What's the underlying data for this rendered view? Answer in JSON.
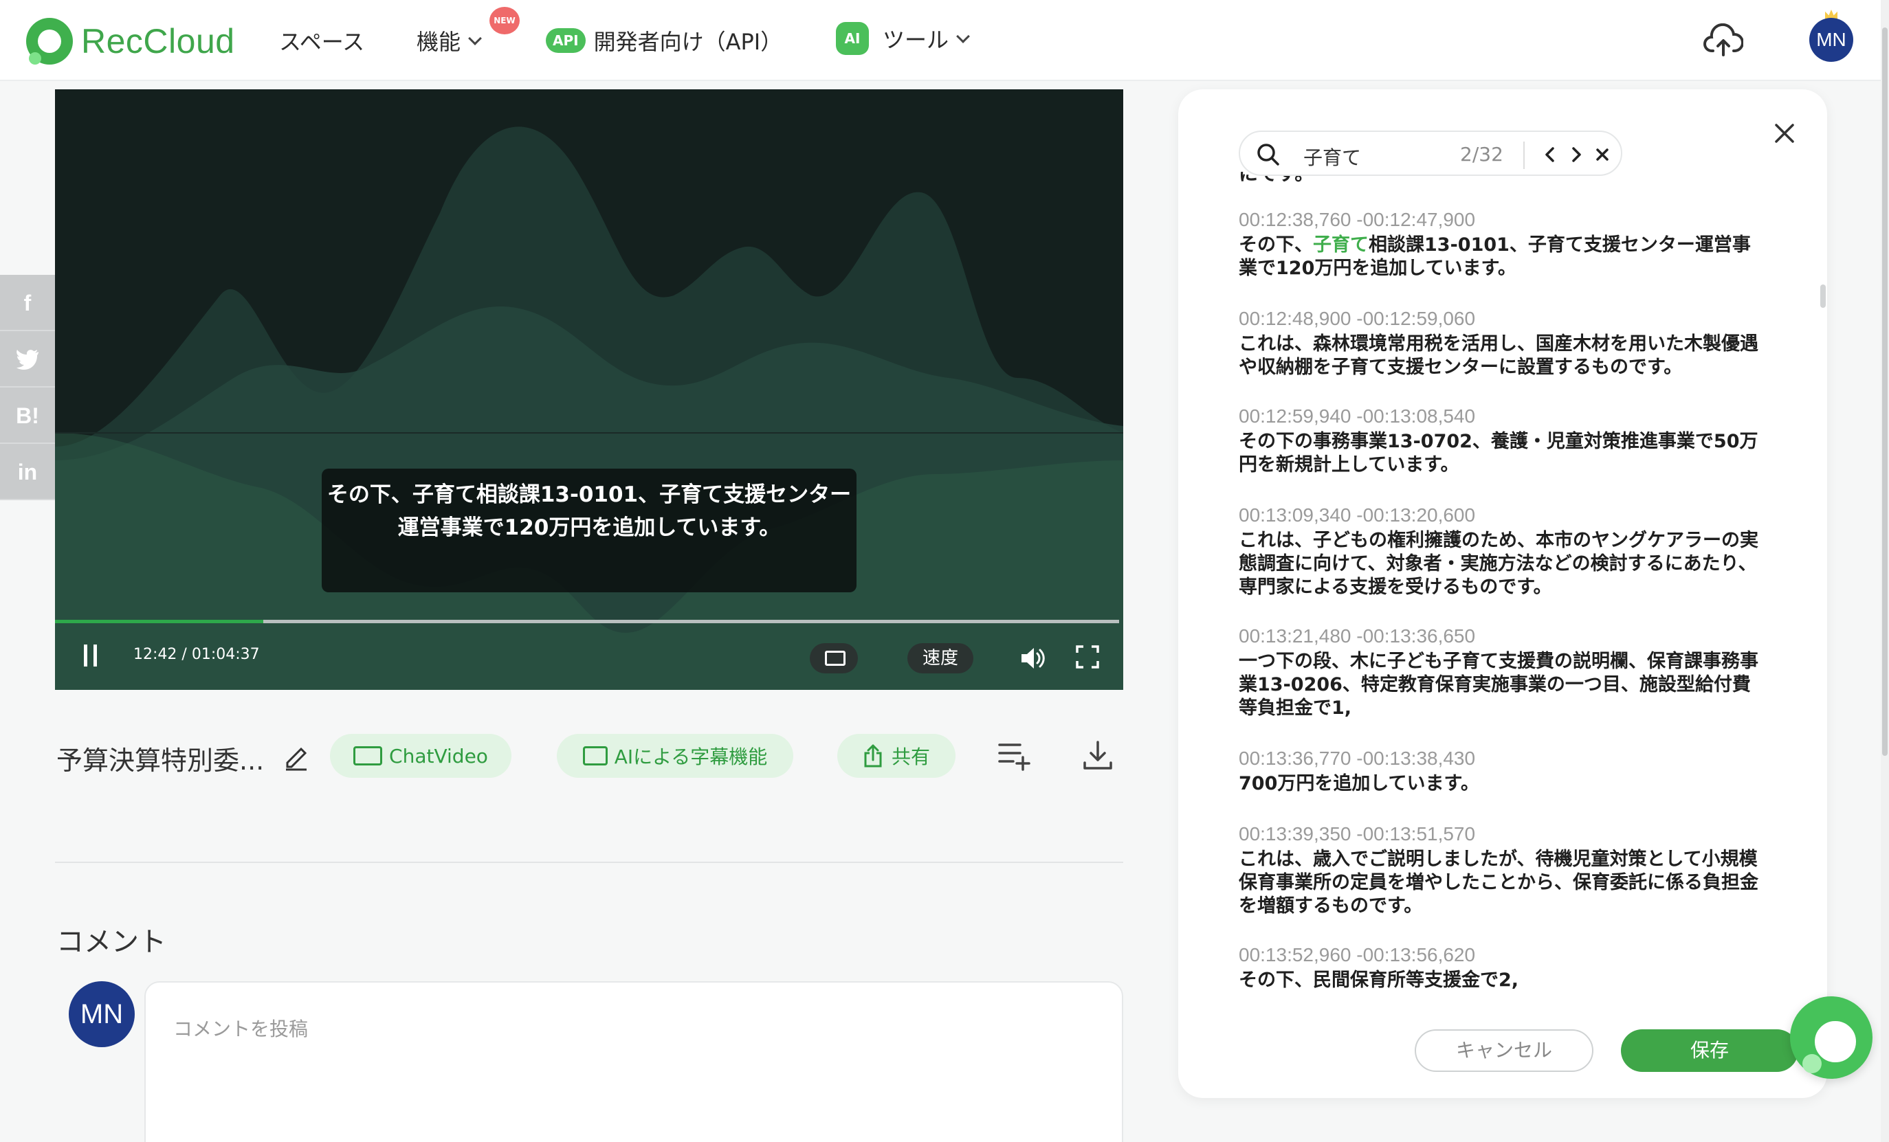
{
  "header": {
    "brand": "RecCloud",
    "nav": {
      "space": "スペース",
      "features": "機能",
      "new_badge": "NEW",
      "api_badge": "API",
      "developer": "開発者向け（API）",
      "ai_badge": "AI",
      "tools": "ツール"
    },
    "avatar_initials": "MN"
  },
  "social": [
    "f",
    "t",
    "B!",
    "in"
  ],
  "player": {
    "subtitle": "その下、子育て相談課13-0101、子育て支援センター運営事業で120万円を追加しています。",
    "current_time": "12:42",
    "time_separator": "/",
    "duration": "01:04:37",
    "progress_fraction": 0.196,
    "speed_label": "速度"
  },
  "actions": {
    "video_title": "予算決算特別委...",
    "chatvideo": "ChatVideo",
    "ai_subtitle": "AIによる字幕機能",
    "share": "共有"
  },
  "comments": {
    "heading": "コメント",
    "avatar_initials": "MN",
    "placeholder": "コメントを投稿"
  },
  "transcript": {
    "search_query": "子育て",
    "match_counter": "2/32",
    "cut_line": "にです。",
    "segments": [
      {
        "ts": "00:12:38,760 -00:12:47,900",
        "pre": "その下、",
        "hl": "子育て",
        "post": "相談課13-0101、子育て支援センター運営事業で120万円を追加しています。"
      },
      {
        "ts": "00:12:48,900 -00:12:59,060",
        "pre": "これは、森林環境常用税を活用し、国産木材を用いた木製優遇や収納棚を子育て支援センターに設置するものです。",
        "hl": "",
        "post": ""
      },
      {
        "ts": "00:12:59,940 -00:13:08,540",
        "pre": "その下の事務事業13-0702、養護・児童対策推進事業で50万円を新規計上しています。",
        "hl": "",
        "post": ""
      },
      {
        "ts": "00:13:09,340 -00:13:20,600",
        "pre": "これは、子どもの権利擁護のため、本市のヤングケアラーの実態調査に向けて、対象者・実施方法などの検討するにあたり、専門家による支援を受けるものです。",
        "hl": "",
        "post": ""
      },
      {
        "ts": "00:13:21,480 -00:13:36,650",
        "pre": "一つ下の段、木に子ども子育て支援費の説明欄、保育課事務事業13-0206、特定教育保育実施事業の一つ目、施設型給付費等負担金で1,",
        "hl": "",
        "post": ""
      },
      {
        "ts": "00:13:36,770 -00:13:38,430",
        "pre": "700万円を追加しています。",
        "hl": "",
        "post": ""
      },
      {
        "ts": "00:13:39,350 -00:13:51,570",
        "pre": "これは、歳入でご説明しましたが、待機児童対策として小規模保育事業所の定員を増やしたことから、保育委託に係る負担金を増額するものです。",
        "hl": "",
        "post": ""
      },
      {
        "ts": "00:13:52,960 -00:13:56,620",
        "pre": "その下、民間保育所等支援金で2,",
        "hl": "",
        "post": ""
      }
    ],
    "cancel": "キャンセル",
    "save": "保存"
  },
  "colors": {
    "brand_green": "#3fa648",
    "highlight": "#3fae4c",
    "avatar_blue": "#1e3a8a"
  }
}
